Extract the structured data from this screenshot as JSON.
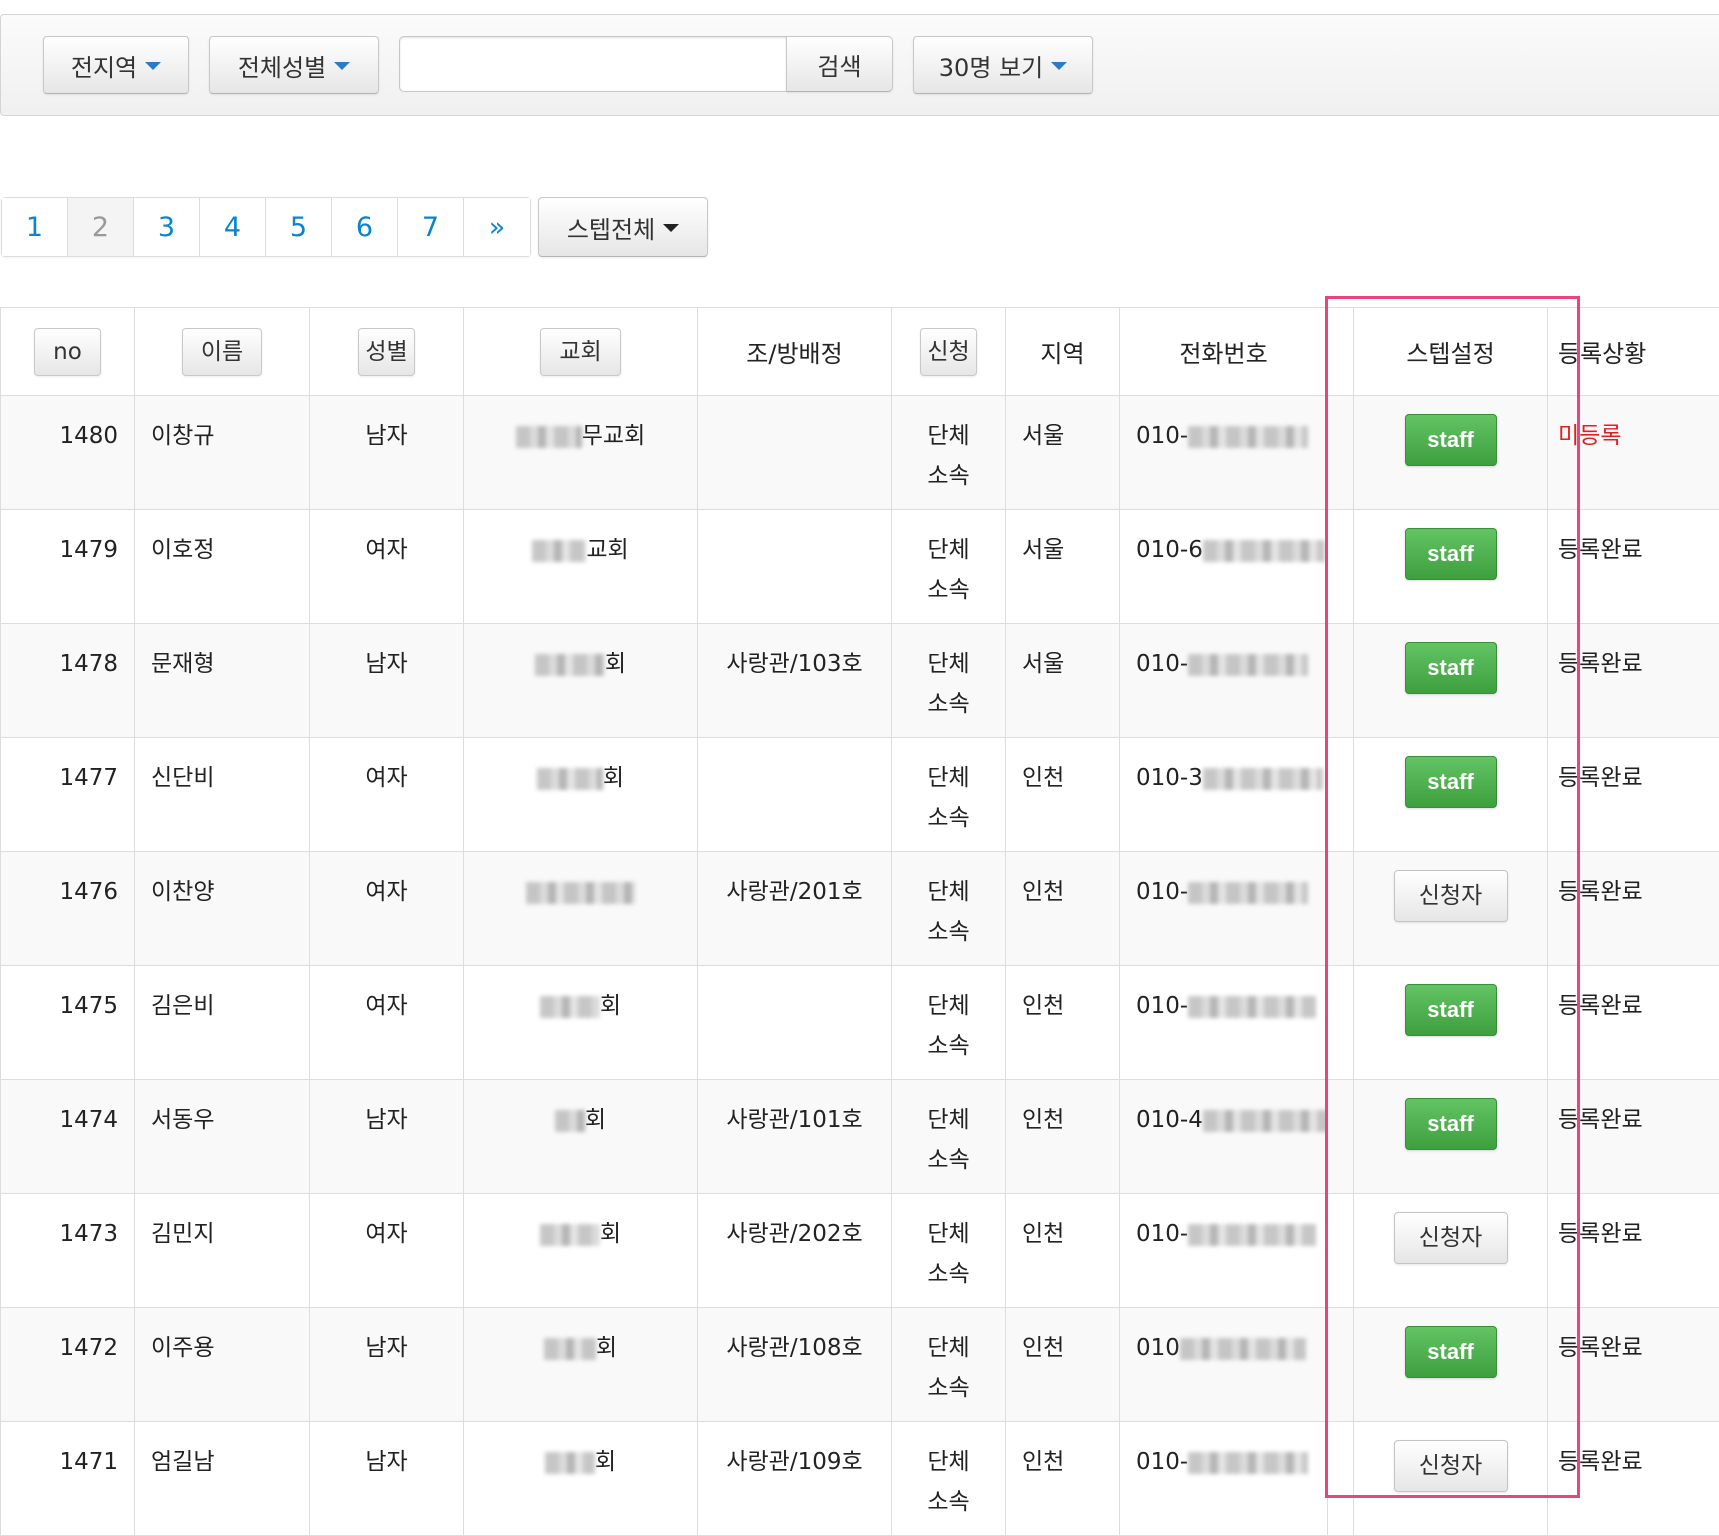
{
  "filters": {
    "region_label": "전지역",
    "gender_label": "전체성별",
    "search_placeholder": "",
    "search_button": "검색",
    "per_page_label": "30명 보기"
  },
  "pagination": {
    "pages": [
      "1",
      "2",
      "3",
      "4",
      "5",
      "6",
      "7",
      "»"
    ],
    "active": "2",
    "step_filter_label": "스텝전체"
  },
  "table": {
    "headers": {
      "no": "no",
      "name": "이름",
      "gender": "성별",
      "church": "교회",
      "assign": "조/방배정",
      "apply": "신청",
      "region": "지역",
      "phone": "전화번호",
      "step": "스텝설정",
      "status": "등록상황"
    },
    "rows": [
      {
        "no": "1480",
        "name": "이창규",
        "gender": "남자",
        "church": "무교회",
        "assign": "",
        "apply_line1": "단체",
        "apply_line2": "소속",
        "region": "서울",
        "phone": "010-",
        "step": "staff",
        "status": "미등록"
      },
      {
        "no": "1479",
        "name": "이호정",
        "gender": "여자",
        "church": "교회",
        "assign": "",
        "apply_line1": "단체",
        "apply_line2": "소속",
        "region": "서울",
        "phone": "010-6",
        "step": "staff",
        "status": "등록완료"
      },
      {
        "no": "1478",
        "name": "문재형",
        "gender": "남자",
        "church": "회",
        "assign": "사랑관/103호",
        "apply_line1": "단체",
        "apply_line2": "소속",
        "region": "서울",
        "phone": "010-",
        "step": "staff",
        "status": "등록완료"
      },
      {
        "no": "1477",
        "name": "신단비",
        "gender": "여자",
        "church": "회",
        "assign": "",
        "apply_line1": "단체",
        "apply_line2": "소속",
        "region": "인천",
        "phone": "010-3",
        "step": "staff",
        "status": "등록완료"
      },
      {
        "no": "1476",
        "name": "이찬양",
        "gender": "여자",
        "church": "",
        "assign": "사랑관/201호",
        "apply_line1": "단체",
        "apply_line2": "소속",
        "region": "인천",
        "phone": "010-",
        "step": "신청자",
        "status": "등록완료"
      },
      {
        "no": "1475",
        "name": "김은비",
        "gender": "여자",
        "church": "회",
        "assign": "",
        "apply_line1": "단체",
        "apply_line2": "소속",
        "region": "인천",
        "phone": "010-",
        "step": "staff",
        "status": "등록완료"
      },
      {
        "no": "1474",
        "name": "서동우",
        "gender": "남자",
        "church": "회",
        "assign": "사랑관/101호",
        "apply_line1": "단체",
        "apply_line2": "소속",
        "region": "인천",
        "phone": "010-4",
        "step": "staff",
        "status": "등록완료"
      },
      {
        "no": "1473",
        "name": "김민지",
        "gender": "여자",
        "church": "회",
        "assign": "사랑관/202호",
        "apply_line1": "단체",
        "apply_line2": "소속",
        "region": "인천",
        "phone": "010-",
        "step": "신청자",
        "status": "등록완료"
      },
      {
        "no": "1472",
        "name": "이주용",
        "gender": "남자",
        "church": "회",
        "assign": "사랑관/108호",
        "apply_line1": "단체",
        "apply_line2": "소속",
        "region": "인천",
        "phone": "010",
        "step": "staff",
        "status": "등록완료"
      },
      {
        "no": "1471",
        "name": "엄길남",
        "gender": "남자",
        "church": "회",
        "assign": "사랑관/109호",
        "apply_line1": "단체",
        "apply_line2": "소속",
        "region": "인천",
        "phone": "010-",
        "step": "신청자",
        "status": "등록완료"
      }
    ]
  },
  "colors": {
    "link_blue": "#0a84d0",
    "staff_green": "#4cae4c",
    "unregistered_red": "#e02020",
    "highlight_pink": "#e8457a"
  }
}
